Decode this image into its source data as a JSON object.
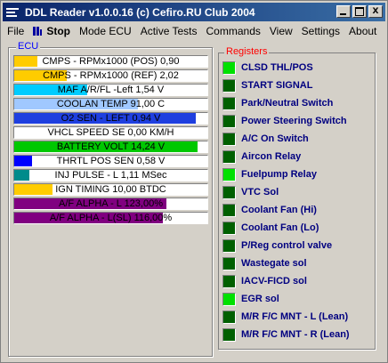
{
  "window": {
    "title": "DDL Reader v1.0.0.16 (c)   Cefiro.RU Club 2004",
    "minimize_label": "",
    "maximize_label": "",
    "close_label": "X"
  },
  "menu": {
    "file": "File",
    "stop": "Stop",
    "mode_ecu": "Mode ECU",
    "active_tests": "Active Tests",
    "commands": "Commands",
    "view": "View",
    "settings": "Settings",
    "about": "About"
  },
  "ecu": {
    "group_label": "ECU",
    "gauges": [
      {
        "label": "CMPS - RPMx1000 (POS) 0,90",
        "level": 0.12,
        "color": "#ffcc00"
      },
      {
        "label": "CMPS - RPMx1000 (REF) 2,02",
        "level": 0.27,
        "color": "#ffcc00"
      },
      {
        "label": "MAF A/R/FL -Left 1,54 V",
        "level": 0.38,
        "color": "#00ccff"
      },
      {
        "label": "COOLAN TEMP 91,00 C",
        "level": 0.64,
        "color": "#a0c8ff"
      },
      {
        "label": "O2 SEN - LEFT 0,94 V",
        "level": 0.94,
        "color": "#1f3fdf"
      },
      {
        "label": "VHCL SPEED SE 0,00 KM/H",
        "level": 0.0,
        "color": "#ffcc00"
      },
      {
        "label": "BATTERY VOLT 14,24 V",
        "level": 0.95,
        "color": "#00c800"
      },
      {
        "label": "THRTL POS SEN 0,58 V",
        "level": 0.09,
        "color": "#0000ff"
      },
      {
        "label": "INJ PULSE - L 1,11 MSec",
        "level": 0.08,
        "color": "#008b8b"
      },
      {
        "label": "IGN TIMING 10,00 BTDC",
        "level": 0.2,
        "color": "#ffcc00"
      },
      {
        "label": "A/F ALPHA - L 123,00%",
        "level": 0.79,
        "color": "#800080"
      },
      {
        "label": "A/F ALPHA - L(SL) 116,00%",
        "level": 0.77,
        "color": "#800080"
      }
    ]
  },
  "registers": {
    "group_label": "Registers",
    "items": [
      {
        "label": "CLSD THL/POS",
        "state": "on"
      },
      {
        "label": "START SIGNAL",
        "state": "off"
      },
      {
        "label": "Park/Neutral Switch",
        "state": "off"
      },
      {
        "label": "Power Steering Switch",
        "state": "off"
      },
      {
        "label": "A/C On Switch",
        "state": "off"
      },
      {
        "label": "Aircon Relay",
        "state": "off"
      },
      {
        "label": "Fuelpump Relay",
        "state": "on"
      },
      {
        "label": "VTC Sol",
        "state": "off"
      },
      {
        "label": "Coolant Fan (Hi)",
        "state": "off"
      },
      {
        "label": "Coolant Fan (Lo)",
        "state": "off"
      },
      {
        "label": "P/Reg control valve",
        "state": "off"
      },
      {
        "label": "Wastegate sol",
        "state": "off"
      },
      {
        "label": "IACV-FICD sol",
        "state": "off"
      },
      {
        "label": "EGR sol",
        "state": "on"
      },
      {
        "label": "M/R F/C MNT - L (Lean)",
        "state": "off"
      },
      {
        "label": "M/R F/C MNT - R (Lean)",
        "state": "off"
      }
    ]
  },
  "colors": {
    "led_on": "#00e000",
    "led_off": "#006000",
    "register_text": "#000080",
    "ecu_label": "#0000ff",
    "registers_label": "#ff0000",
    "titlebar": "#0a246a"
  }
}
